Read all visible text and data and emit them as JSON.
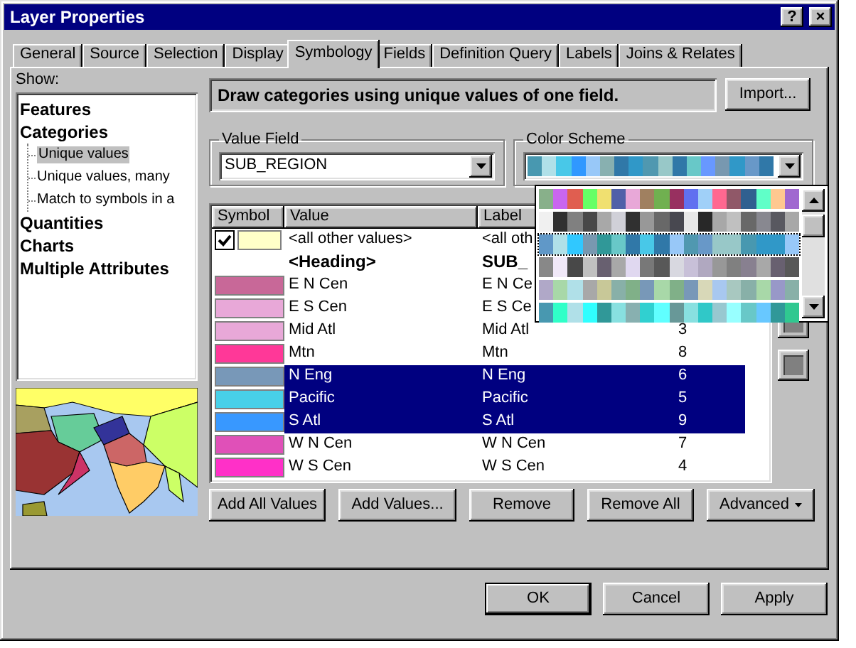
{
  "window": {
    "title": "Layer Properties",
    "title_buttons": [
      "?",
      "×"
    ]
  },
  "tabs": [
    {
      "label": "General",
      "selected": false
    },
    {
      "label": "Source",
      "selected": false
    },
    {
      "label": "Selection",
      "selected": false
    },
    {
      "label": "Display",
      "selected": false
    },
    {
      "label": "Symbology",
      "selected": true
    },
    {
      "label": "Fields",
      "selected": false
    },
    {
      "label": "Definition Query",
      "selected": false
    },
    {
      "label": "Labels",
      "selected": false
    },
    {
      "label": "Joins & Relates",
      "selected": false
    }
  ],
  "show": {
    "label": "Show:",
    "tree": [
      {
        "label": "Features",
        "selected": false
      },
      {
        "label": "Categories",
        "selected": false,
        "children": [
          {
            "label": "Unique values",
            "selected": true
          },
          {
            "label": "Unique values, many",
            "selected": false
          },
          {
            "label": "Match to symbols in a",
            "selected": false
          }
        ]
      },
      {
        "label": "Quantities",
        "selected": false
      },
      {
        "label": "Charts",
        "selected": false
      },
      {
        "label": "Multiple Attributes",
        "selected": false
      }
    ]
  },
  "description": "Draw categories using unique values of one field.",
  "import_button": "Import...",
  "value_field": {
    "label": "Value Field",
    "value": "SUB_REGION"
  },
  "color_scheme": {
    "label": "Color Scheme",
    "swatches": [
      {
        "color": "#4898b0"
      },
      {
        "color": "#b0e0e8"
      },
      {
        "color": "#48c8e8"
      },
      {
        "color": "#3098ff"
      },
      {
        "color": "#98c8f8"
      },
      {
        "color": "#88b0b0"
      },
      {
        "color": "#3078a8"
      },
      {
        "color": "#3098c8"
      },
      {
        "color": "#5098b0"
      },
      {
        "color": "#98c8c8"
      },
      {
        "color": "#3078a8"
      },
      {
        "color": "#68c8c8"
      },
      {
        "color": "#6898ff"
      },
      {
        "color": "#7898b0"
      },
      {
        "color": "#3098c8"
      },
      {
        "color": "#6898c8"
      },
      {
        "color": "#3078a8"
      }
    ],
    "ramps": [
      {
        "selected": false,
        "swatches": [
          {
            "color": "#88b08a"
          },
          {
            "color": "#c966f0"
          },
          {
            "color": "#e05e50"
          },
          {
            "color": "#66ff66"
          },
          {
            "color": "#f0e070"
          },
          {
            "color": "#5060a8"
          },
          {
            "color": "#e8a8d8"
          },
          {
            "color": "#a08060"
          },
          {
            "color": "#70b050"
          },
          {
            "color": "#983060"
          },
          {
            "color": "#6070f0"
          },
          {
            "color": "#a0d0f8"
          },
          {
            "color": "#ff6890"
          },
          {
            "color": "#905868"
          },
          {
            "color": "#306090"
          },
          {
            "color": "#60ffc8"
          },
          {
            "color": "#ffc890"
          },
          {
            "color": "#a068d0"
          }
        ]
      },
      {
        "selected": false,
        "swatches": [
          {
            "color": "#f0f0f0"
          },
          {
            "color": "#303030"
          },
          {
            "color": "#808080"
          },
          {
            "color": "#484848"
          },
          {
            "color": "#a8a8a8"
          },
          {
            "color": "#d0d0d8"
          },
          {
            "color": "#303030"
          },
          {
            "color": "#989898"
          },
          {
            "color": "#686868"
          },
          {
            "color": "#484850"
          },
          {
            "color": "#e8e8e8"
          },
          {
            "color": "#282828"
          },
          {
            "color": "#a8a8a8"
          },
          {
            "color": "#c0c0c0"
          },
          {
            "color": "#686868"
          },
          {
            "color": "#888890"
          },
          {
            "color": "#585860"
          },
          {
            "color": "#a8a8a8"
          }
        ]
      },
      {
        "selected": true,
        "swatches": [
          {
            "color": "#6098c8"
          },
          {
            "color": "#b0e0e8"
          },
          {
            "color": "#30c8ff"
          },
          {
            "color": "#7898b0"
          },
          {
            "color": "#309898"
          },
          {
            "color": "#68c8c8"
          },
          {
            "color": "#3078a8"
          },
          {
            "color": "#48c8e8"
          },
          {
            "color": "#3078a8"
          },
          {
            "color": "#98c8f8"
          },
          {
            "color": "#5098b0"
          },
          {
            "color": "#6898c8"
          },
          {
            "color": "#98c8c8"
          },
          {
            "color": "#98c8c8"
          },
          {
            "color": "#4898b0"
          },
          {
            "color": "#3098c8"
          },
          {
            "color": "#3098c8"
          },
          {
            "color": "#98c8f8"
          }
        ]
      },
      {
        "selected": false,
        "swatches": [
          {
            "color": "#888888"
          },
          {
            "color": "#f0e8f8"
          },
          {
            "color": "#484848"
          },
          {
            "color": "#c0c0c0"
          },
          {
            "color": "#686070"
          },
          {
            "color": "#a8a8a8"
          },
          {
            "color": "#e0d8f0"
          },
          {
            "color": "#787878"
          },
          {
            "color": "#585858"
          },
          {
            "color": "#d8d8e0"
          },
          {
            "color": "#c8c0d8"
          },
          {
            "color": "#b0a8c0"
          },
          {
            "color": "#989898"
          },
          {
            "color": "#808080"
          },
          {
            "color": "#888090"
          },
          {
            "color": "#a8a8a8"
          },
          {
            "color": "#686070"
          },
          {
            "color": "#585858"
          }
        ]
      },
      {
        "selected": false,
        "swatches": [
          {
            "color": "#b0a8c8"
          },
          {
            "color": "#a8d8a8"
          },
          {
            "color": "#b0e0e8"
          },
          {
            "color": "#a8a8a8"
          },
          {
            "color": "#c8c898"
          },
          {
            "color": "#88b0a8"
          },
          {
            "color": "#80b088"
          },
          {
            "color": "#7898b8"
          },
          {
            "color": "#a8d8a8"
          },
          {
            "color": "#80b088"
          },
          {
            "color": "#7898b8"
          },
          {
            "color": "#d8d8b8"
          },
          {
            "color": "#a8c8f0"
          },
          {
            "color": "#a8c8c0"
          },
          {
            "color": "#88b0a8"
          },
          {
            "color": "#a8d8a8"
          },
          {
            "color": "#9898c8"
          },
          {
            "color": "#88b0a8"
          }
        ]
      },
      {
        "selected": false,
        "swatches": [
          {
            "color": "#4898b0"
          },
          {
            "color": "#30ffc8"
          },
          {
            "color": "#b0e0e8"
          },
          {
            "color": "#30ffff"
          },
          {
            "color": "#309898"
          },
          {
            "color": "#88e0e0"
          },
          {
            "color": "#88b0b0"
          },
          {
            "color": "#30d0d0"
          },
          {
            "color": "#60ffff"
          },
          {
            "color": "#689898"
          },
          {
            "color": "#88e0e0"
          },
          {
            "color": "#30c8c8"
          },
          {
            "color": "#98c8d0"
          },
          {
            "color": "#98ffff"
          },
          {
            "color": "#68c8c8"
          },
          {
            "color": "#68c8ff"
          },
          {
            "color": "#309898"
          },
          {
            "color": "#30c890"
          }
        ]
      }
    ]
  },
  "table": {
    "columns": [
      "Symbol",
      "Value",
      "Label"
    ],
    "rows": [
      {
        "kind": "default",
        "checked": true,
        "color": "#ffffc8",
        "value": "<all other values>",
        "label": "<all oth",
        "selected": false
      },
      {
        "kind": "heading",
        "value": "<Heading>",
        "label": "SUB_",
        "selected": false
      },
      {
        "kind": "value",
        "color": "#c86898",
        "value": "E N Cen",
        "label": "E N Ce",
        "selected": false
      },
      {
        "kind": "value",
        "color": "#e8a8d8",
        "value": "E S Cen",
        "label": "E S Ce",
        "selected": false
      },
      {
        "kind": "value",
        "color": "#e8a8d8",
        "value": "Mid Atl",
        "label": "Mid Atl",
        "count": "3",
        "selected": false
      },
      {
        "kind": "value",
        "color": "#ff3898",
        "value": "Mtn",
        "label": "Mtn",
        "count": "8",
        "selected": false
      },
      {
        "kind": "value",
        "color": "#7898b8",
        "value": "N Eng",
        "label": "N Eng",
        "count": "6",
        "selected": true
      },
      {
        "kind": "value",
        "color": "#48d0e8",
        "value": "Pacific",
        "label": "Pacific",
        "count": "5",
        "selected": true
      },
      {
        "kind": "value",
        "color": "#3898ff",
        "value": "S Atl",
        "label": "S Atl",
        "count": "9",
        "selected": true
      },
      {
        "kind": "value",
        "color": "#e050b8",
        "value": "W N Cen",
        "label": "W N Cen",
        "count": "7",
        "selected": false
      },
      {
        "kind": "value",
        "color": "#ff30c8",
        "value": "W S Cen",
        "label": "W S Cen",
        "count": "4",
        "selected": false
      }
    ]
  },
  "buttons": [
    {
      "label": "Add All Values",
      "kind": "plain"
    },
    {
      "label": "Add Values...",
      "kind": "plain"
    },
    {
      "label": "Remove",
      "kind": "plain"
    },
    {
      "label": "Remove All",
      "kind": "plain"
    },
    {
      "label": "Advanced",
      "kind": "menu"
    }
  ],
  "dialog_buttons": [
    {
      "label": "OK",
      "default": true
    },
    {
      "label": "Cancel",
      "default": false
    },
    {
      "label": "Apply",
      "default": false
    }
  ]
}
